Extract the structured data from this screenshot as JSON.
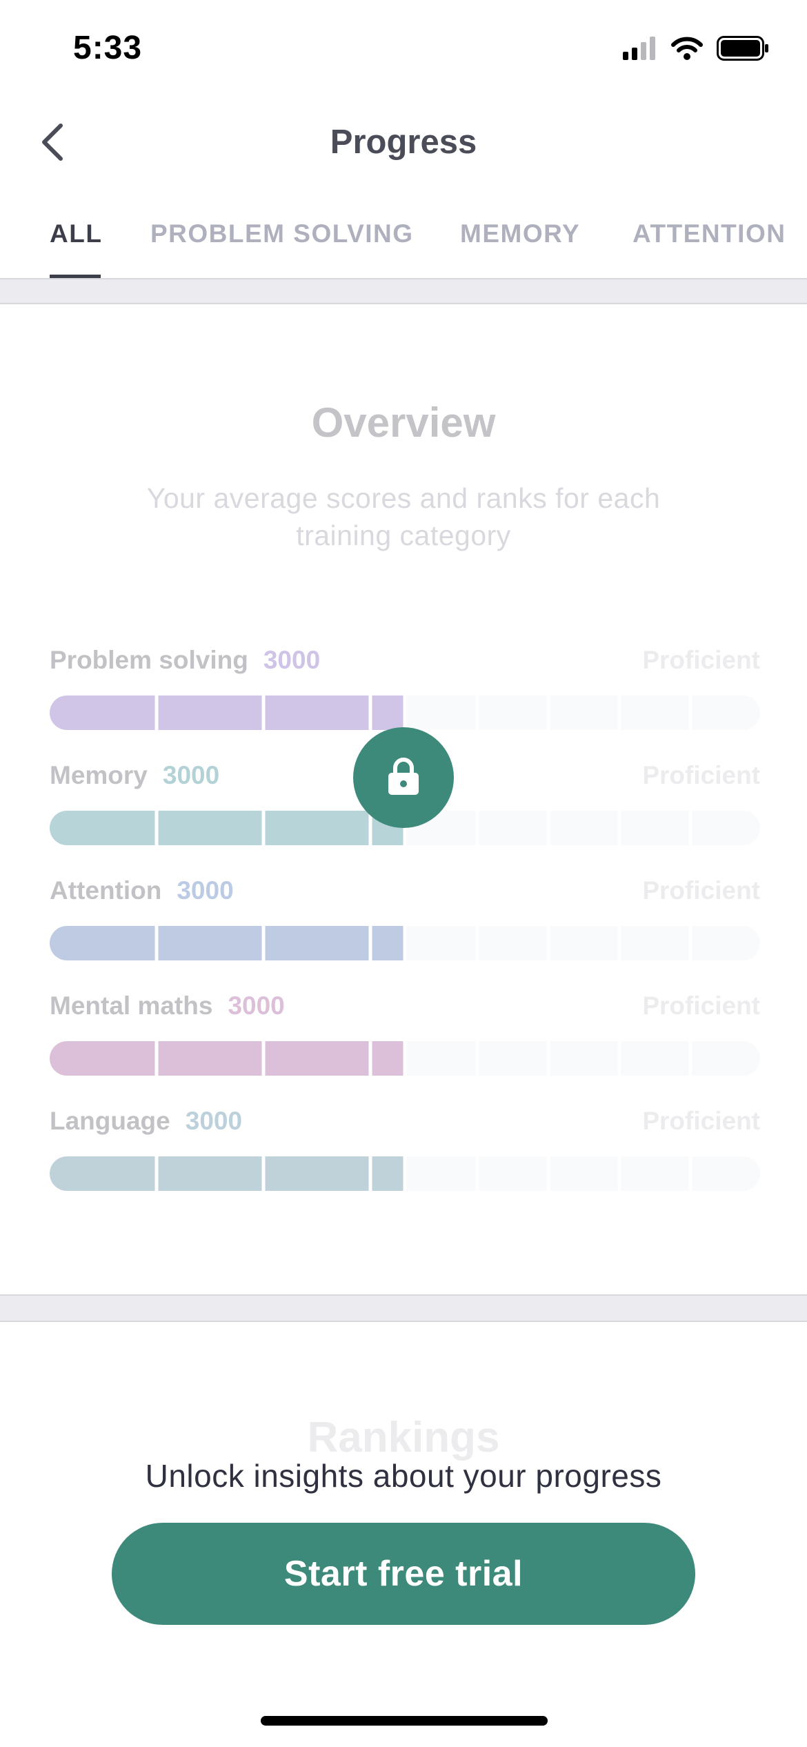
{
  "status_bar": {
    "time": "5:33",
    "signal_icon": "cellular-signal-icon",
    "wifi_icon": "wifi-icon",
    "battery_icon": "battery-icon"
  },
  "nav": {
    "title": "Progress",
    "back_icon": "chevron-left-icon"
  },
  "tabs": [
    {
      "label": "ALL",
      "active": true
    },
    {
      "label": "PROBLEM SOLVING",
      "active": false
    },
    {
      "label": "MEMORY",
      "active": false
    },
    {
      "label": "ATTENTION",
      "active": false
    }
  ],
  "overview": {
    "title": "Overview",
    "subtitle": "Your average scores and ranks for each training category",
    "categories": [
      {
        "name": "Problem solving",
        "score": "3000",
        "level": "Proficient",
        "fraction": 0.5,
        "color": "#d0c5e6",
        "score_color": "#cfc3e8"
      },
      {
        "name": "Memory",
        "score": "3000",
        "level": "Proficient",
        "fraction": 0.5,
        "color": "#b7d5d8",
        "score_color": "#b2d2d6"
      },
      {
        "name": "Attention",
        "score": "3000",
        "level": "Proficient",
        "fraction": 0.5,
        "color": "#bfcae3",
        "score_color": "#bccbe4"
      },
      {
        "name": "Mental maths",
        "score": "3000",
        "level": "Proficient",
        "fraction": 0.5,
        "color": "#dcc0d9",
        "score_color": "#dcc0d9"
      },
      {
        "name": "Language",
        "score": "3000",
        "level": "Proficient",
        "fraction": 0.5,
        "color": "#bfd2da",
        "score_color": "#bcd1db"
      }
    ],
    "lock_icon": "lock-icon"
  },
  "rankings": {
    "title": "Rankings"
  },
  "paywall": {
    "message": "Unlock insights about your progress",
    "button_label": "Start free trial"
  },
  "colors": {
    "accent": "#3d8a7b",
    "track": "#f9fafc"
  }
}
